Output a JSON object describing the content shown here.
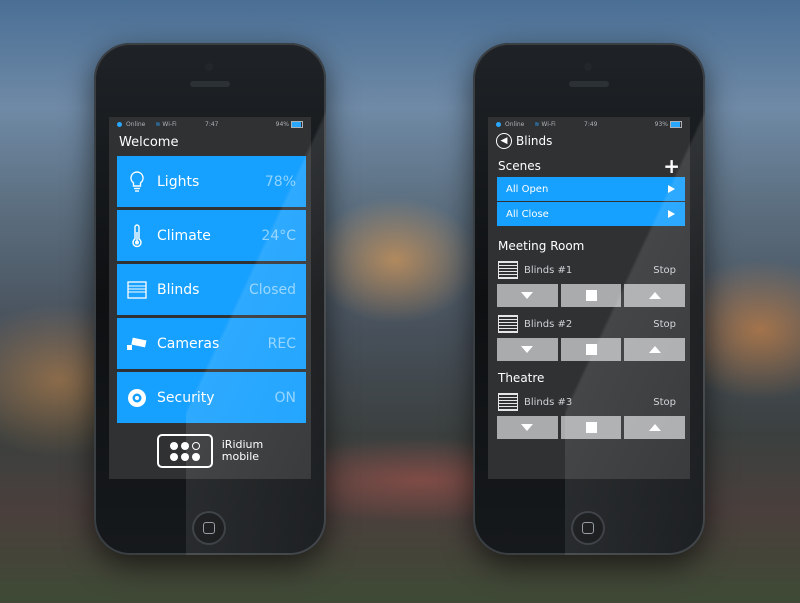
{
  "status_left": {
    "network": "Online",
    "wifi": "Wi-Fi",
    "time": "7:47",
    "battery": "94%"
  },
  "status_right": {
    "network": "Online",
    "wifi": "Wi-Fi",
    "time": "7:49",
    "battery": "93%"
  },
  "home": {
    "title": "Welcome",
    "tiles": [
      {
        "label": "Lights",
        "value": "78%",
        "icon": "lightbulb-icon"
      },
      {
        "label": "Climate",
        "value": "24°C",
        "icon": "thermometer-icon"
      },
      {
        "label": "Blinds",
        "value": "Closed",
        "icon": "blinds-icon"
      },
      {
        "label": "Cameras",
        "value": "REC",
        "icon": "camera-icon"
      },
      {
        "label": "Security",
        "value": "ON",
        "icon": "shield-icon"
      }
    ],
    "logo": {
      "line1": "iRidium",
      "line2": "mobile"
    }
  },
  "blinds": {
    "title": "Blinds",
    "scenes_label": "Scenes",
    "scenes": [
      "All Open",
      "All Close"
    ],
    "rooms": [
      {
        "name": "Meeting Room",
        "items": [
          {
            "name": "Blinds #1",
            "state": "Stop"
          },
          {
            "name": "Blinds #2",
            "state": "Stop"
          }
        ]
      },
      {
        "name": "Theatre",
        "items": [
          {
            "name": "Blinds #3",
            "state": "Stop"
          }
        ]
      }
    ]
  },
  "colors": {
    "accent": "#16a0ff",
    "screen_bg": "#2f3133",
    "button_gray": "#a9abad"
  }
}
